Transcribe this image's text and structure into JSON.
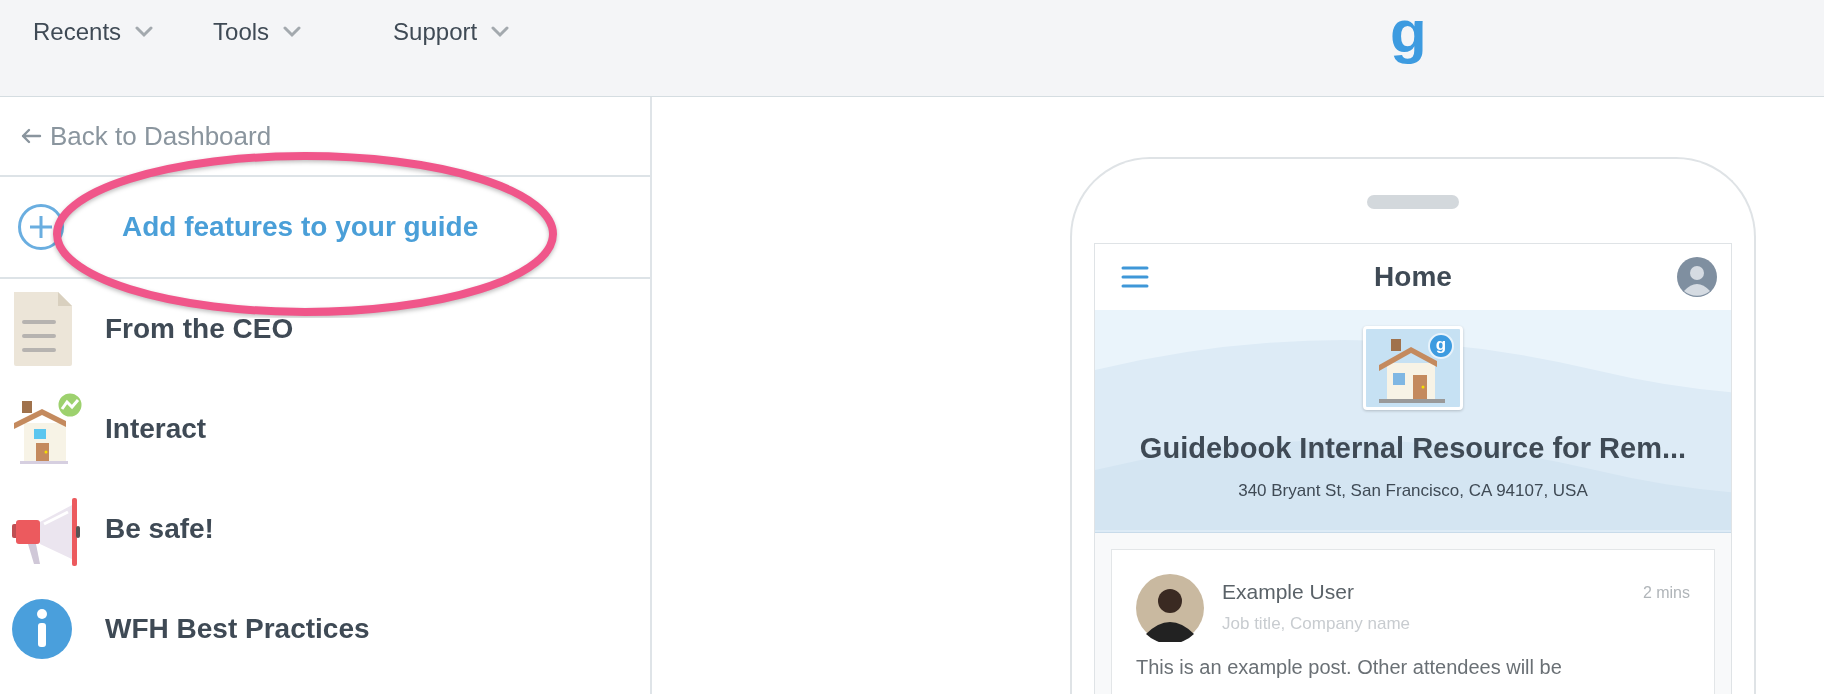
{
  "top_nav": {
    "menus": [
      {
        "label": "Recents"
      },
      {
        "label": "Tools"
      },
      {
        "label": "Support"
      }
    ],
    "logo": "g"
  },
  "sidebar": {
    "back_link": "Back to Dashboard",
    "add_features": "Add features to your guide",
    "items": [
      {
        "label": "From the CEO",
        "kind": "document"
      },
      {
        "label": "Interact",
        "kind": "house"
      },
      {
        "label": "Be safe!",
        "kind": "megaphone"
      },
      {
        "label": "WFH Best Practices",
        "kind": "info"
      }
    ]
  },
  "annotation": {
    "kind": "ellipse"
  },
  "phone": {
    "header": {
      "title": "Home"
    },
    "banner": {
      "badge": "g",
      "title": "Guidebook Internal Resource for Rem...",
      "address": "340 Bryant St, San Francisco, CA 94107, USA"
    },
    "post": {
      "author": "Example User",
      "subtitle": "Job title, Company name",
      "time": "2 mins",
      "text": "This is an example post. Other attendees will be"
    }
  }
}
